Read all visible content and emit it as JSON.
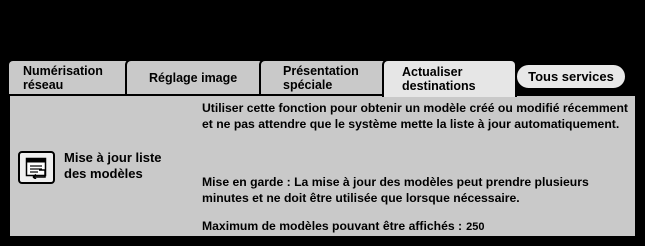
{
  "tabs": [
    {
      "label": "Numérisation\nréseau"
    },
    {
      "label": "Réglage image"
    },
    {
      "label": "Présentation\nspéciale"
    },
    {
      "label": "Actualiser\ndestinations"
    }
  ],
  "all_services_label": "Tous services",
  "update_button": {
    "label": "Mise à jour liste\ndes modèles",
    "icon": "template-list-icon"
  },
  "description": {
    "paragraph1": "Utiliser cette fonction pour obtenir un modèle créé ou modifié récemment et ne pas attendre que le système mette la liste à jour automatiquement.",
    "paragraph2": "Mise en garde : La mise à jour des modèles peut prendre plusieurs minutes et ne doit être utilisée que lorsque nécessaire.",
    "max_label": "Maximum de modèles pouvant être affichés :",
    "max_value": "250"
  },
  "colors": {
    "panel": "#c9c9c9",
    "background": "#000000"
  }
}
